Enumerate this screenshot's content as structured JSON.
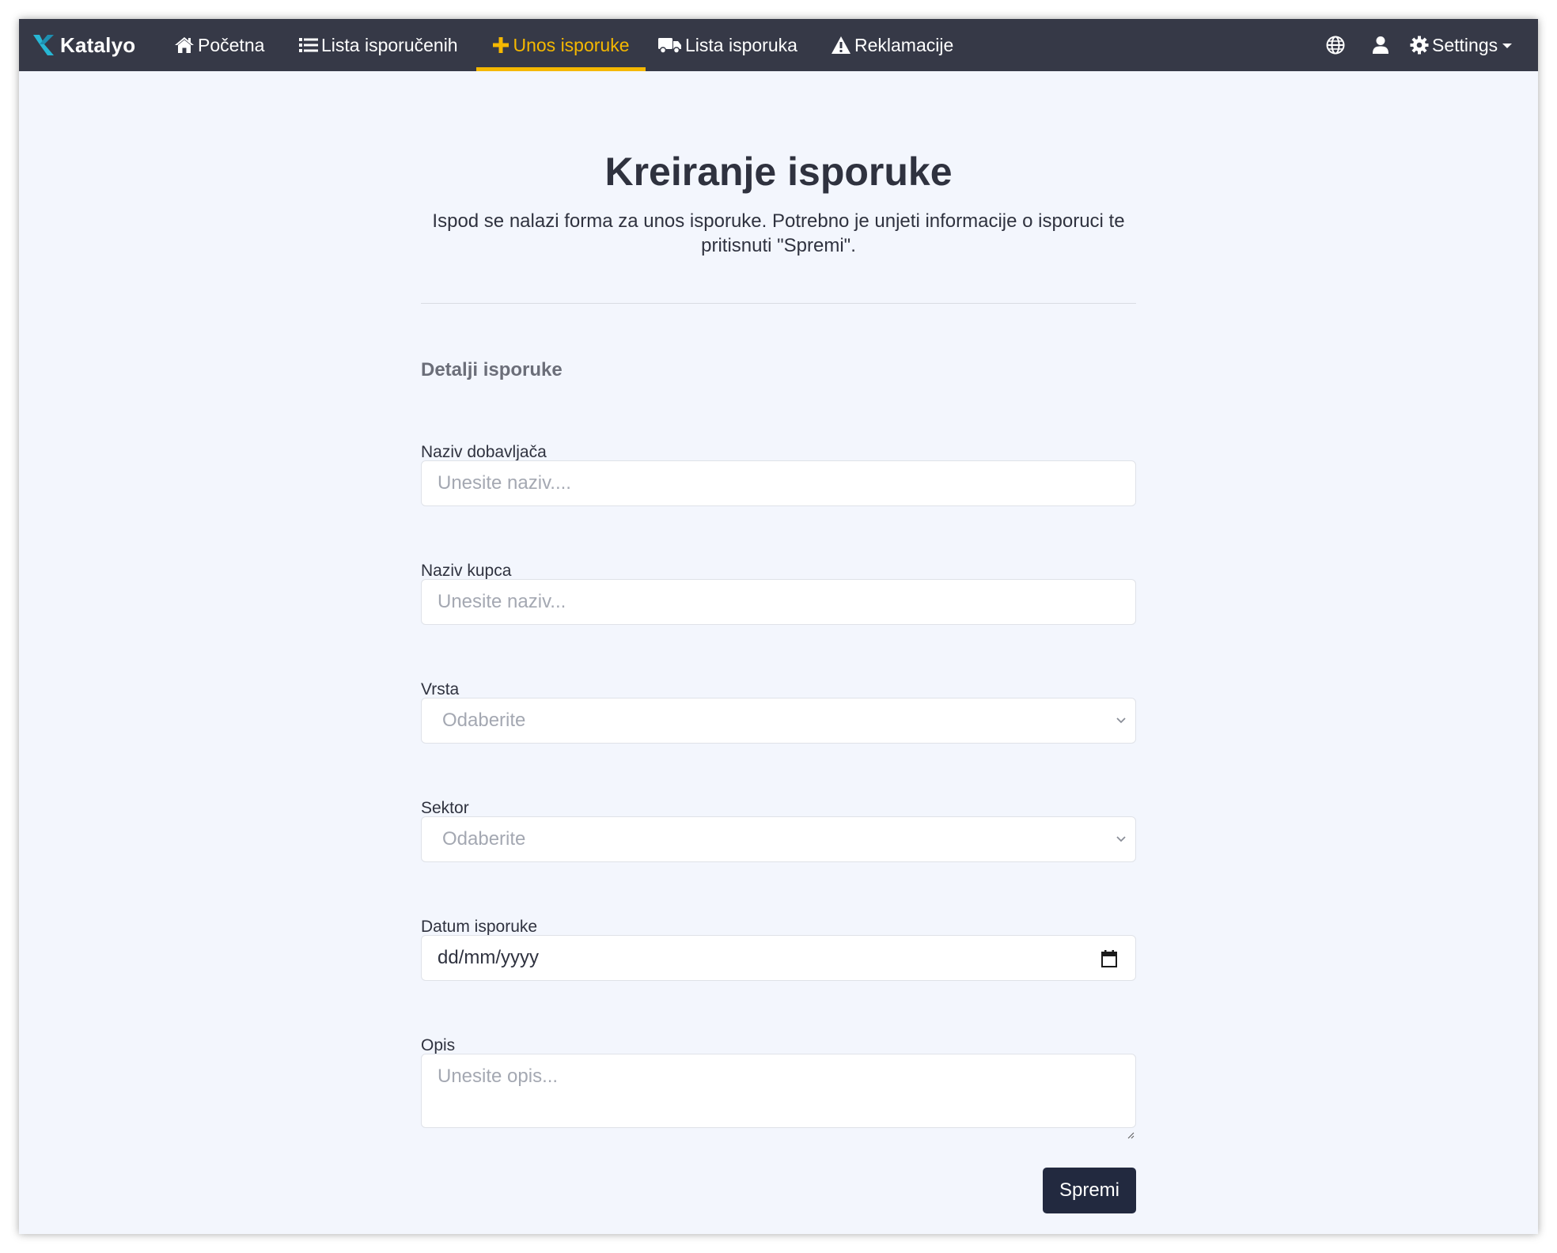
{
  "nav": {
    "brand": "Katalyo",
    "items": [
      {
        "label": "Početna",
        "icon": "home-icon"
      },
      {
        "label": "Lista isporučenih",
        "icon": "list-icon"
      },
      {
        "label": "Unos isporuke",
        "icon": "plus-icon",
        "active": true
      },
      {
        "label": "Lista isporuka",
        "icon": "truck-icon"
      },
      {
        "label": "Reklamacije",
        "icon": "warning-icon"
      }
    ],
    "right": {
      "globe_icon": "globe-icon",
      "user_icon": "user-icon",
      "settings_label": "Settings",
      "settings_icon": "gear-icon"
    },
    "colors": {
      "bar": "#363947",
      "accent": "#f5b800"
    }
  },
  "page": {
    "title": "Kreiranje isporuke",
    "description": "Ispod se nalazi forma za unos isporuke. Potrebno je unjeti informacije o isporuci te pritisnuti \"Spremi\"."
  },
  "form": {
    "section_title": "Detalji isporuke",
    "supplier": {
      "label": "Naziv dobavljača",
      "placeholder": "Unesite naziv...."
    },
    "customer": {
      "label": "Naziv kupca",
      "placeholder": "Unesite naziv..."
    },
    "type": {
      "label": "Vrsta",
      "selected": "Odaberite"
    },
    "sector": {
      "label": "Sektor",
      "selected": "Odaberite"
    },
    "date": {
      "label": "Datum isporuke",
      "value": "dd/mm/yyyy"
    },
    "description": {
      "label": "Opis",
      "placeholder": "Unesite opis..."
    },
    "submit_label": "Spremi"
  }
}
